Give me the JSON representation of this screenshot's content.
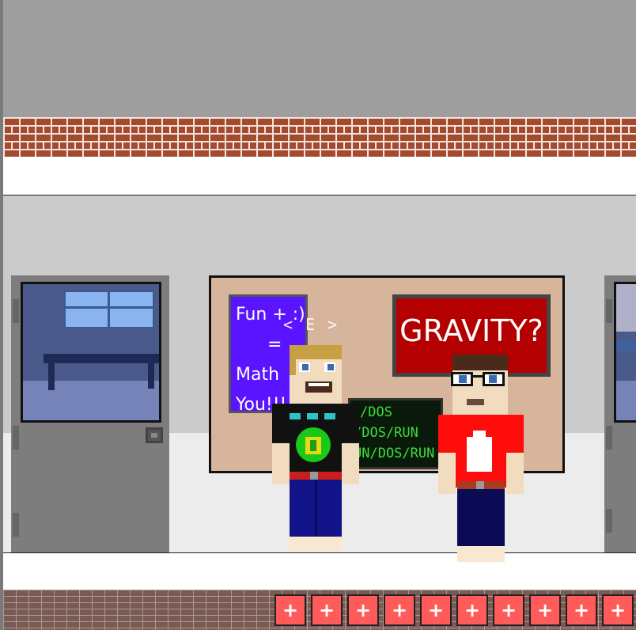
{
  "board": {
    "purple_lines": [
      "Fun + :)",
      "=",
      "Math",
      "You!!!"
    ],
    "gravity_text": "GRAVITY?",
    "terminal_lines": [
      "/DOS",
      "/DOS/RUN",
      "UN/DOS/RUN"
    ]
  },
  "hint": "< E >",
  "hotbar": {
    "slots": [
      "+",
      "+",
      "+",
      "+",
      "+",
      "+",
      "+",
      "+",
      "+",
      "+"
    ]
  },
  "colors": {
    "slot": "#ff5b5b",
    "gravity_sign": "#b40000",
    "purple_sign": "#5a14ff",
    "terminal_text": "#3ddc3d"
  }
}
